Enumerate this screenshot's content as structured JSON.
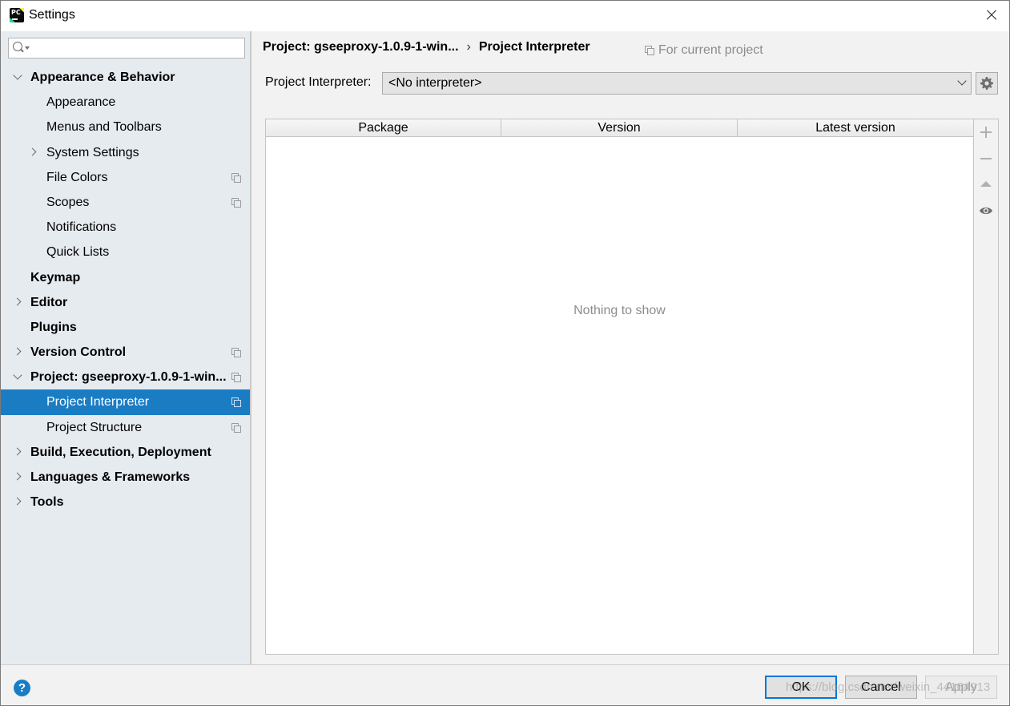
{
  "window": {
    "title": "Settings"
  },
  "search": {
    "placeholder": "",
    "value": ""
  },
  "sidebar": {
    "items": [
      {
        "label": "Appearance & Behavior",
        "level": 0,
        "bold": true,
        "arrow": "down",
        "copy": false,
        "selected": false,
        "name": "sidebar-item-appearance-behavior"
      },
      {
        "label": "Appearance",
        "level": 1,
        "bold": false,
        "arrow": "",
        "copy": false,
        "selected": false,
        "name": "sidebar-item-appearance"
      },
      {
        "label": "Menus and Toolbars",
        "level": 1,
        "bold": false,
        "arrow": "",
        "copy": false,
        "selected": false,
        "name": "sidebar-item-menus-toolbars"
      },
      {
        "label": "System Settings",
        "level": 1,
        "bold": false,
        "arrow": "right",
        "copy": false,
        "selected": false,
        "name": "sidebar-item-system-settings"
      },
      {
        "label": "File Colors",
        "level": 1,
        "bold": false,
        "arrow": "",
        "copy": true,
        "selected": false,
        "name": "sidebar-item-file-colors"
      },
      {
        "label": "Scopes",
        "level": 1,
        "bold": false,
        "arrow": "",
        "copy": true,
        "selected": false,
        "name": "sidebar-item-scopes"
      },
      {
        "label": "Notifications",
        "level": 1,
        "bold": false,
        "arrow": "",
        "copy": false,
        "selected": false,
        "name": "sidebar-item-notifications"
      },
      {
        "label": "Quick Lists",
        "level": 1,
        "bold": false,
        "arrow": "",
        "copy": false,
        "selected": false,
        "name": "sidebar-item-quick-lists"
      },
      {
        "label": "Keymap",
        "level": 0,
        "bold": true,
        "arrow": "",
        "copy": false,
        "selected": false,
        "name": "sidebar-item-keymap"
      },
      {
        "label": "Editor",
        "level": 0,
        "bold": true,
        "arrow": "right",
        "copy": false,
        "selected": false,
        "name": "sidebar-item-editor"
      },
      {
        "label": "Plugins",
        "level": 0,
        "bold": true,
        "arrow": "",
        "copy": false,
        "selected": false,
        "name": "sidebar-item-plugins"
      },
      {
        "label": "Version Control",
        "level": 0,
        "bold": true,
        "arrow": "right",
        "copy": true,
        "selected": false,
        "name": "sidebar-item-version-control"
      },
      {
        "label": "Project: gseeproxy-1.0.9-1-win...",
        "level": 0,
        "bold": true,
        "arrow": "down",
        "copy": true,
        "selected": false,
        "name": "sidebar-item-project"
      },
      {
        "label": "Project Interpreter",
        "level": 1,
        "bold": false,
        "arrow": "",
        "copy": true,
        "selected": true,
        "name": "sidebar-item-project-interpreter"
      },
      {
        "label": "Project Structure",
        "level": 1,
        "bold": false,
        "arrow": "",
        "copy": true,
        "selected": false,
        "name": "sidebar-item-project-structure"
      },
      {
        "label": "Build, Execution, Deployment",
        "level": 0,
        "bold": true,
        "arrow": "right",
        "copy": false,
        "selected": false,
        "name": "sidebar-item-build-execution-deployment"
      },
      {
        "label": "Languages & Frameworks",
        "level": 0,
        "bold": true,
        "arrow": "right",
        "copy": false,
        "selected": false,
        "name": "sidebar-item-languages-frameworks"
      },
      {
        "label": "Tools",
        "level": 0,
        "bold": true,
        "arrow": "right",
        "copy": false,
        "selected": false,
        "name": "sidebar-item-tools"
      }
    ]
  },
  "main": {
    "breadcrumb": {
      "parent": "Project: gseeproxy-1.0.9-1-win...",
      "separator": "›",
      "current": "Project Interpreter"
    },
    "scope_label": "For current project",
    "interpreter": {
      "label": "Project Interpreter:",
      "value": "<No interpreter>"
    },
    "table": {
      "columns": [
        "Package",
        "Version",
        "Latest version"
      ],
      "empty_text": "Nothing to show"
    }
  },
  "buttons": {
    "help": "?",
    "ok": "OK",
    "cancel": "Cancel",
    "apply": "Apply"
  },
  "watermark": "https://blog.csdn.net/weixin_44164913",
  "colors": {
    "selection": "#1a7dc4",
    "sidebar_bg": "#e6ebf0",
    "ok_border": "#0078d7"
  }
}
